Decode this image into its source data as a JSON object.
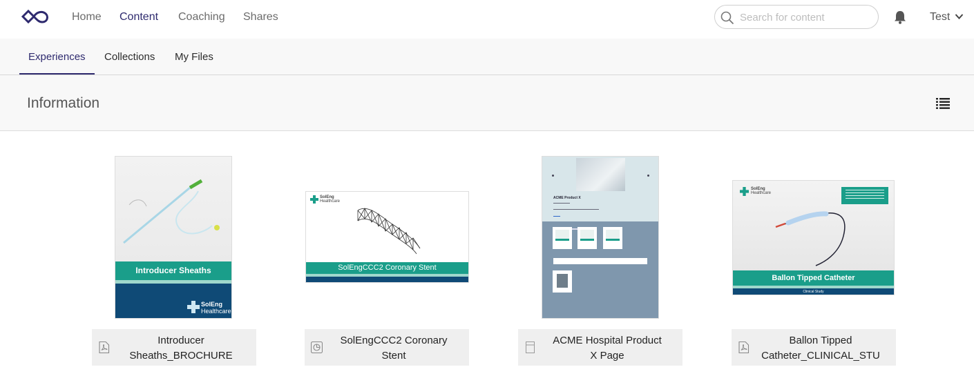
{
  "topnav": {
    "items": [
      "Home",
      "Content",
      "Coaching",
      "Shares"
    ],
    "active": "Content",
    "search_placeholder": "Search for content",
    "user": "Test"
  },
  "subtabs": {
    "items": [
      "Experiences",
      "Collections",
      "My Files"
    ],
    "active": "Experiences"
  },
  "section": {
    "title": "Information"
  },
  "cards": [
    {
      "title": "Introducer Sheaths_BROCHURE",
      "title_lines": [
        "Introducer",
        "Sheaths_BROCHURE"
      ],
      "file_icon": "pdf-icon",
      "thumb_band": "Introducer Sheaths",
      "thumb_logo": [
        "SolEng",
        "Healthcare"
      ]
    },
    {
      "title": "SolEngCCC2 Coronary Stent",
      "title_lines": [
        "SolEngCCC2 Coronary",
        "Stent"
      ],
      "file_icon": "presentation-icon",
      "thumb_band": "SolEngCCC2 Coronary Stent",
      "thumb_logo": [
        "SolEng",
        "Healthcare"
      ]
    },
    {
      "title": "ACME Hospital Product X Page",
      "title_lines": [
        "ACME Hospital Product",
        "X Page"
      ],
      "file_icon": "page-icon",
      "thumb_heading": "ACME Product X"
    },
    {
      "title": "Ballon Tipped Catheter_CLINICAL_STU",
      "title_lines": [
        "Ballon Tipped",
        "Catheter_CLINICAL_STU"
      ],
      "file_icon": "pdf-icon",
      "thumb_band": "Ballon Tipped Catheter",
      "thumb_subband": "Clinical Study",
      "thumb_logo": [
        "SolEng",
        "Healthcare"
      ]
    }
  ],
  "colors": {
    "accent": "#2e2a6e",
    "teal": "#1a9e8a",
    "navy": "#0f4a76"
  }
}
